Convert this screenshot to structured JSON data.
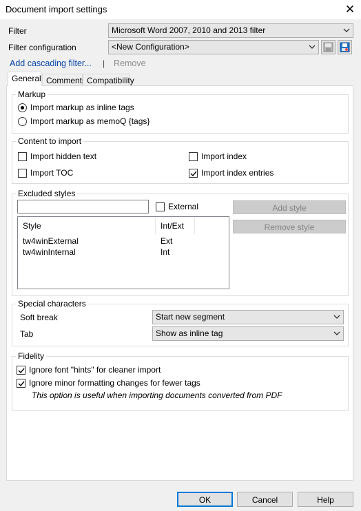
{
  "window": {
    "title": "Document import settings"
  },
  "filter": {
    "label": "Filter",
    "value": "Microsoft Word 2007, 2010 and 2013 filter"
  },
  "filter_config": {
    "label": "Filter configuration",
    "value": "<New Configuration>"
  },
  "links": {
    "add_cascading": "Add cascading filter...",
    "separator": "|",
    "remove": "Remove"
  },
  "tabs": [
    {
      "label": "General"
    },
    {
      "label": "Comments"
    },
    {
      "label": "Compatibility"
    }
  ],
  "markup": {
    "title": "Markup",
    "option_inline": "Import markup as inline tags",
    "option_memoq": "Import markup as memoQ {tags}",
    "selected": "inline"
  },
  "content": {
    "title": "Content to import",
    "hidden_text": {
      "label": "Import hidden text",
      "checked": false
    },
    "toc": {
      "label": "Import TOC",
      "checked": false
    },
    "index": {
      "label": "Import index",
      "checked": false
    },
    "index_entries": {
      "label": "Import index entries",
      "checked": true
    }
  },
  "excluded": {
    "title": "Excluded styles",
    "input_value": "",
    "external_label": "External",
    "external_checked": false,
    "add_style": "Add style",
    "remove_style": "Remove style",
    "columns": [
      "Style",
      "Int/Ext"
    ],
    "rows": [
      {
        "style": "tw4winExternal",
        "type": "Ext"
      },
      {
        "style": "tw4winInternal",
        "type": "Int"
      }
    ]
  },
  "special": {
    "title": "Special characters",
    "soft_break_label": "Soft break",
    "soft_break_value": "Start new segment",
    "tab_label": "Tab",
    "tab_value": "Show as inline tag"
  },
  "fidelity": {
    "title": "Fidelity",
    "ignore_hints": {
      "label": "Ignore font \"hints\" for cleaner import",
      "checked": true
    },
    "ignore_minor": {
      "label": "Ignore minor formatting changes for fewer tags",
      "checked": true
    },
    "note": "This option is useful when importing documents converted from PDF"
  },
  "buttons": {
    "ok": "OK",
    "cancel": "Cancel",
    "help": "Help"
  }
}
